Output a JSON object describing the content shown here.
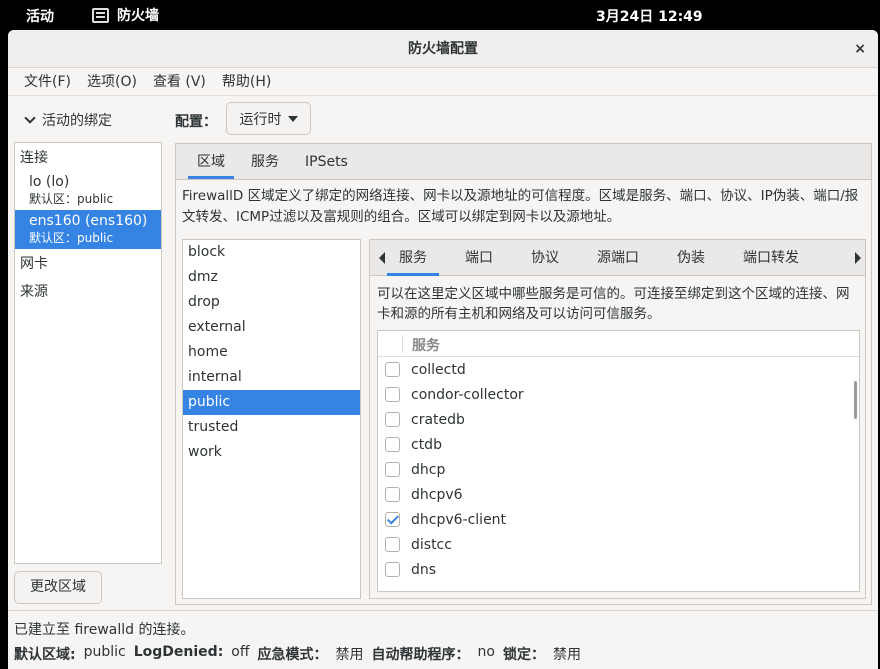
{
  "topbar": {
    "activities": "活动",
    "app_name": "防火墙",
    "clock": "3月24日  12:49"
  },
  "window": {
    "title": "防火墙配置",
    "close": "×"
  },
  "menu": [
    "文件(F)",
    "选项(O)",
    "查看 (V)",
    "帮助(H)"
  ],
  "left": {
    "toggle_label": "活动的绑定",
    "connections_header": "连接",
    "connections": [
      {
        "name": "lo (lo)",
        "zone": "默认区：public"
      },
      {
        "name": "ens160 (ens160)",
        "zone": "默认区：public"
      }
    ],
    "nic_header": "网卡",
    "source_header": "来源",
    "change_zone_button": "更改区域"
  },
  "config": {
    "label": "配置：",
    "value": "运行时"
  },
  "main_tabs": [
    "区域",
    "服务",
    "IPSets"
  ],
  "zone_description": "FirewallD 区域定义了绑定的网络连接、网卡以及源地址的可信程度。区域是服务、端口、协议、IP伪装、端口/报文转发、ICMP过滤以及富规则的组合。区域可以绑定到网卡以及源地址。",
  "zones": [
    "block",
    "dmz",
    "drop",
    "external",
    "home",
    "internal",
    "public",
    "trusted",
    "work"
  ],
  "selected_zone": "public",
  "inner_tabs": [
    "服务",
    "端口",
    "协议",
    "源端口",
    "伪装",
    "端口转发"
  ],
  "services_description": "可以在这里定义区域中哪些服务是可信的。可连接至绑定到这个区域的连接、网卡和源的所有主机和网络及可以访问可信服务。",
  "services_header": "服务",
  "services": [
    {
      "name": "collectd",
      "checked": false
    },
    {
      "name": "condor-collector",
      "checked": false
    },
    {
      "name": "cratedb",
      "checked": false
    },
    {
      "name": "ctdb",
      "checked": false
    },
    {
      "name": "dhcp",
      "checked": false
    },
    {
      "name": "dhcpv6",
      "checked": false
    },
    {
      "name": "dhcpv6-client",
      "checked": true
    },
    {
      "name": "distcc",
      "checked": false
    },
    {
      "name": "dns",
      "checked": false
    }
  ],
  "status": {
    "connection": "已建立至 firewalld 的连接。",
    "default_zone_label": "默认区域:",
    "default_zone": "public",
    "log_denied_label": "LogDenied:",
    "log_denied": "off",
    "panic_label": "应急模式：",
    "panic": "禁用",
    "helpers_label": "自动帮助程序：",
    "helpers": "no",
    "lockdown_label": "锁定：",
    "lockdown": "禁用"
  }
}
